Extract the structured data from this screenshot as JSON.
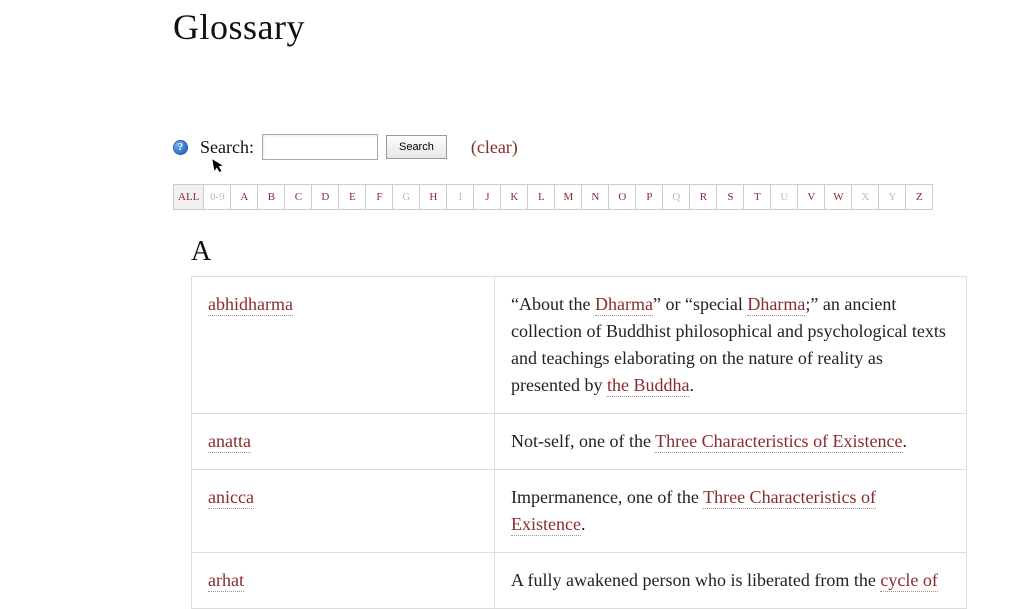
{
  "title": "Glossary",
  "search": {
    "label": "Search:",
    "button": "Search",
    "clear": "(clear)",
    "value": ""
  },
  "az": [
    {
      "label": "ALL",
      "active": true,
      "disabled": false
    },
    {
      "label": "0-9",
      "active": false,
      "disabled": true
    },
    {
      "label": "A",
      "active": false,
      "disabled": false
    },
    {
      "label": "B",
      "active": false,
      "disabled": false
    },
    {
      "label": "C",
      "active": false,
      "disabled": false
    },
    {
      "label": "D",
      "active": false,
      "disabled": false
    },
    {
      "label": "E",
      "active": false,
      "disabled": false
    },
    {
      "label": "F",
      "active": false,
      "disabled": false
    },
    {
      "label": "G",
      "active": false,
      "disabled": true
    },
    {
      "label": "H",
      "active": false,
      "disabled": false
    },
    {
      "label": "I",
      "active": false,
      "disabled": true
    },
    {
      "label": "J",
      "active": false,
      "disabled": false
    },
    {
      "label": "K",
      "active": false,
      "disabled": false
    },
    {
      "label": "L",
      "active": false,
      "disabled": false
    },
    {
      "label": "M",
      "active": false,
      "disabled": false
    },
    {
      "label": "N",
      "active": false,
      "disabled": false
    },
    {
      "label": "O",
      "active": false,
      "disabled": false
    },
    {
      "label": "P",
      "active": false,
      "disabled": false
    },
    {
      "label": "Q",
      "active": false,
      "disabled": true
    },
    {
      "label": "R",
      "active": false,
      "disabled": false
    },
    {
      "label": "S",
      "active": false,
      "disabled": false
    },
    {
      "label": "T",
      "active": false,
      "disabled": false
    },
    {
      "label": "U",
      "active": false,
      "disabled": true
    },
    {
      "label": "V",
      "active": false,
      "disabled": false
    },
    {
      "label": "W",
      "active": false,
      "disabled": false
    },
    {
      "label": "X",
      "active": false,
      "disabled": true
    },
    {
      "label": "Y",
      "active": false,
      "disabled": true
    },
    {
      "label": "Z",
      "active": false,
      "disabled": false
    }
  ],
  "section": {
    "letter": "A",
    "entries": [
      {
        "term": "abhidharma",
        "definition": [
          {
            "t": "text",
            "v": "“About the "
          },
          {
            "t": "link",
            "v": "Dharma"
          },
          {
            "t": "text",
            "v": "” or “special "
          },
          {
            "t": "link",
            "v": "Dharma"
          },
          {
            "t": "text",
            "v": ";” an ancient collection of Buddhist philosophical and psychological texts and teachings elaborating on the nature of reality as presented by "
          },
          {
            "t": "link",
            "v": "the Buddha"
          },
          {
            "t": "text",
            "v": "."
          }
        ]
      },
      {
        "term": "anatta",
        "definition": [
          {
            "t": "text",
            "v": "Not-self, one of the "
          },
          {
            "t": "link",
            "v": "Three Characteristics of Existence"
          },
          {
            "t": "text",
            "v": "."
          }
        ]
      },
      {
        "term": "anicca",
        "definition": [
          {
            "t": "text",
            "v": "Impermanence, one of the "
          },
          {
            "t": "link",
            "v": "Three Characteristics of Existence"
          },
          {
            "t": "text",
            "v": "."
          }
        ]
      },
      {
        "term": "arhat",
        "definition": [
          {
            "t": "text",
            "v": "A fully awakened person who is liberated from the "
          },
          {
            "t": "link",
            "v": "cycle of"
          }
        ]
      }
    ]
  }
}
